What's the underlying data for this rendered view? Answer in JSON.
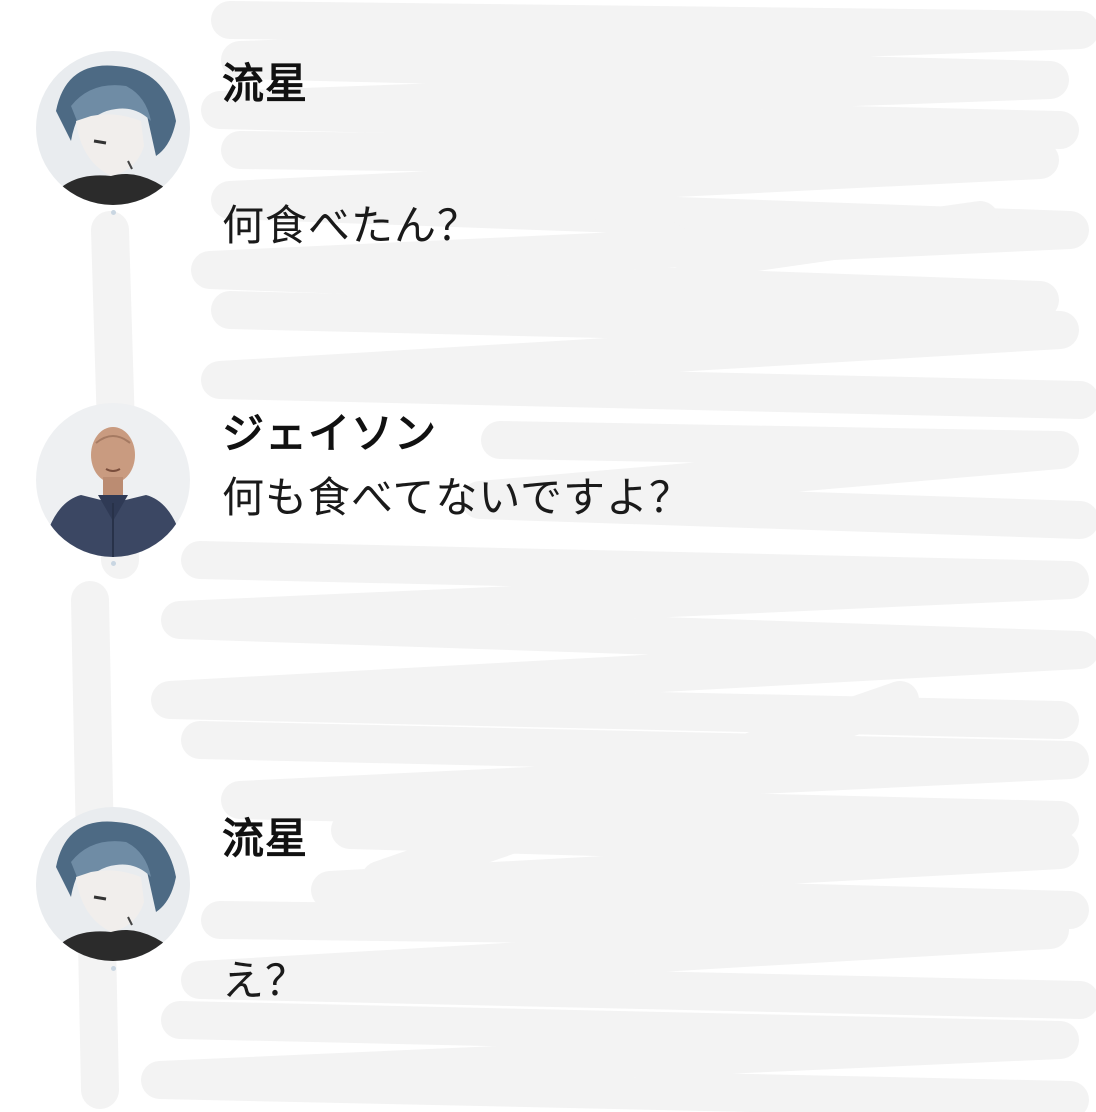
{
  "messages": [
    {
      "sender": "流星",
      "text": "何食べたん？",
      "avatar": "anime-boy-avatar"
    },
    {
      "sender": "ジェイソン",
      "text": "何も食べてないですよ？",
      "avatar": "man-in-shirt-avatar"
    },
    {
      "sender": "流星",
      "text": "え？",
      "avatar": "anime-boy-avatar"
    }
  ],
  "colors": {
    "background": "#ffffff",
    "text": "#1a1a1a",
    "redaction_scribble": "#f4f4f4"
  }
}
